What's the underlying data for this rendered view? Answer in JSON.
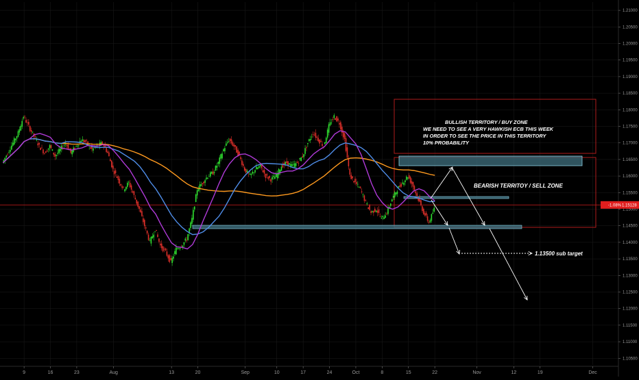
{
  "chart_data": {
    "type": "candlestick",
    "instrument_readout": {
      "change": "-1.08%",
      "price": "1.15128",
      "price_value": 1.15128,
      "badge_color": "#e01e1e"
    },
    "ylim": [
      1.103,
      1.2125
    ],
    "y_ticks": [
      "1.21000",
      "1.20500",
      "1.20000",
      "1.19500",
      "1.19000",
      "1.18500",
      "1.18000",
      "1.17500",
      "1.17000",
      "1.16500",
      "1.16000",
      "1.15500",
      "1.15000",
      "1.14500",
      "1.14000",
      "1.13500",
      "1.13000",
      "1.12500",
      "1.12000",
      "1.11500",
      "1.11000",
      "1.10500"
    ],
    "x_ticks": [
      {
        "label": "9",
        "index": 4
      },
      {
        "label": "16",
        "index": 9
      },
      {
        "label": "23",
        "index": 14
      },
      {
        "label": "Aug",
        "index": 21
      },
      {
        "label": "13",
        "index": 32
      },
      {
        "label": "20",
        "index": 37
      },
      {
        "label": "Sep",
        "index": 46
      },
      {
        "label": "10",
        "index": 52
      },
      {
        "label": "17",
        "index": 57
      },
      {
        "label": "24",
        "index": 62
      },
      {
        "label": "Oct",
        "index": 67
      },
      {
        "label": "8",
        "index": 72
      },
      {
        "label": "15",
        "index": 77
      },
      {
        "label": "22",
        "index": 82
      },
      {
        "label": "Nov",
        "index": 90
      },
      {
        "label": "12",
        "index": 97
      },
      {
        "label": "19",
        "index": 102
      },
      {
        "label": "Dec",
        "index": 112
      }
    ],
    "closes": [
      1.164,
      1.167,
      1.17,
      1.173,
      1.178,
      1.175,
      1.172,
      1.169,
      1.167,
      1.169,
      1.166,
      1.168,
      1.17,
      1.167,
      1.169,
      1.171,
      1.17,
      1.168,
      1.169,
      1.17,
      1.167,
      1.162,
      1.159,
      1.156,
      1.158,
      1.154,
      1.15,
      1.145,
      1.14,
      1.144,
      1.139,
      1.137,
      1.134,
      1.138,
      1.139,
      1.141,
      1.147,
      1.156,
      1.158,
      1.16,
      1.161,
      1.164,
      1.168,
      1.171,
      1.169,
      1.166,
      1.162,
      1.16,
      1.162,
      1.163,
      1.16,
      1.159,
      1.16,
      1.163,
      1.164,
      1.163,
      1.164,
      1.166,
      1.17,
      1.173,
      1.171,
      1.169,
      1.175,
      1.178,
      1.176,
      1.171,
      1.16,
      1.158,
      1.156,
      1.152,
      1.149,
      1.15,
      1.147,
      1.149,
      1.153,
      1.156,
      1.158,
      1.16,
      1.157,
      1.153,
      1.149,
      1.146,
      1.15
    ],
    "sma_series": [
      {
        "name": "",
        "color": "#ff9a1f",
        "period": 30
      },
      {
        "name": "",
        "color": "#4f8de8",
        "period": 12
      },
      {
        "name": "",
        "color": "#b03ad8",
        "period": 6
      }
    ],
    "up_color": "#2fe02f",
    "down_color": "#e0302a",
    "horizontal_line": {
      "value": 1.15128,
      "color": "#b21818"
    },
    "annotations": {
      "bullish_lines": [
        "BULLISH TERRITORY / BUY ZONE",
        "WE NEED TO SEE A VERY HAWKISH ECB THIS WEEK",
        "IN ORDER TO SEE THE PRICE IN THIS TERRITORY",
        "10% PROBABILITY"
      ],
      "bearish_label": "BEARISH TERRITOY / SELL ZONE",
      "sub_target_label": "1.13500 sub target",
      "sub_target_value": 1.135
    }
  }
}
